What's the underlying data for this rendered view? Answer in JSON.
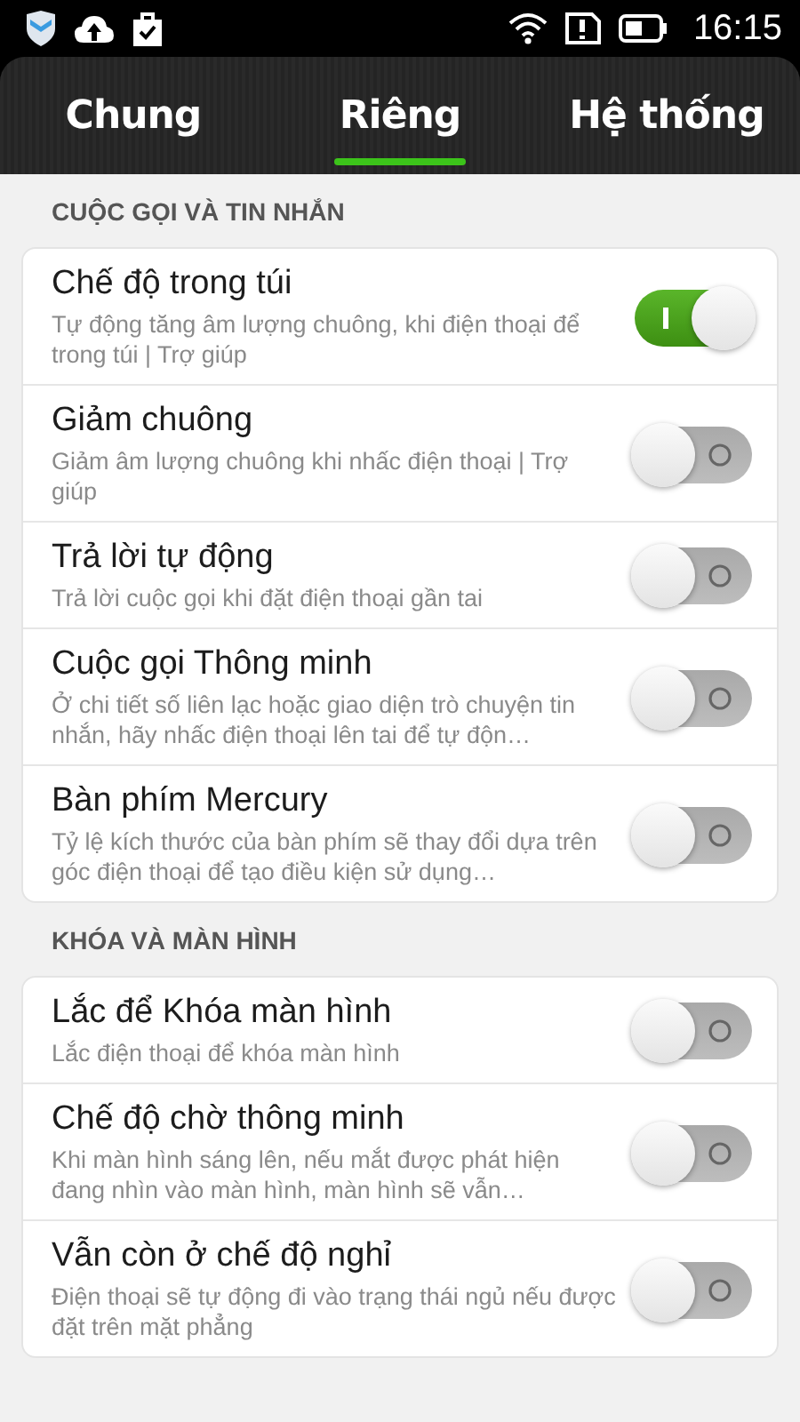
{
  "status_bar": {
    "time": "16:15"
  },
  "tabs": [
    {
      "label": "Chung",
      "selected": false
    },
    {
      "label": "Riêng",
      "selected": true
    },
    {
      "label": "Hệ thống",
      "selected": false
    }
  ],
  "sections": [
    {
      "title": "CUỘC GỌI VÀ TIN NHẮN",
      "items": [
        {
          "title": "Chế độ trong túi",
          "subtitle": "Tự động tăng âm lượng chuông, khi điện thoại để trong túi | Trợ giúp",
          "on": true
        },
        {
          "title": "Giảm chuông",
          "subtitle": "Giảm âm lượng chuông khi nhấc điện thoại | Trợ giúp",
          "on": false
        },
        {
          "title": "Trả lời tự động",
          "subtitle": "Trả lời cuộc gọi khi đặt điện thoại gần tai",
          "on": false
        },
        {
          "title": "Cuộc gọi Thông minh",
          "subtitle": "Ở chi tiết số liên lạc hoặc giao diện trò chuyện tin nhắn, hãy nhấc điện thoại lên tai để tự độn…",
          "on": false
        },
        {
          "title": "Bàn phím Mercury",
          "subtitle": "Tỷ lệ kích thước của bàn phím sẽ thay đổi dựa trên góc điện thoại để tạo điều kiện sử dụng…",
          "on": false
        }
      ]
    },
    {
      "title": "KHÓA VÀ MÀN HÌNH",
      "items": [
        {
          "title": "Lắc để Khóa màn hình",
          "subtitle": "Lắc điện thoại để khóa màn hình",
          "on": false
        },
        {
          "title": "Chế độ chờ thông minh",
          "subtitle": "Khi màn hình sáng lên, nếu mắt được phát hiện đang nhìn vào màn hình, màn hình sẽ vẫn…",
          "on": false
        },
        {
          "title": "Vẫn còn ở chế độ nghỉ",
          "subtitle": "Điện thoại sẽ tự động đi vào trạng thái ngủ nếu được đặt trên mặt phẳng",
          "on": false
        }
      ]
    }
  ]
}
